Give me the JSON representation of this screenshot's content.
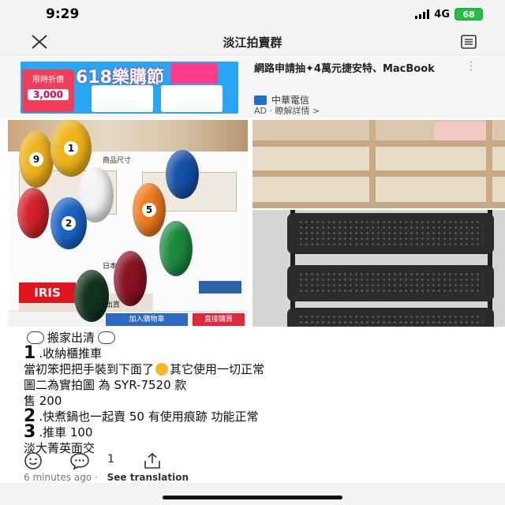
{
  "status": {
    "time": "9:29",
    "network": "4G",
    "battery": "68"
  },
  "nav": {
    "title": "淡江拍賣群",
    "close_icon": "close-icon",
    "menu_icon": "menu-icon"
  },
  "ad": {
    "banner_text": "618樂購節",
    "promo_label": "限時折價",
    "promo_price": "3,000",
    "title": "網路申請抽✦4萬元捷安特、MacBook",
    "sponsor": "中華電信",
    "meta": "AD · 瞭解詳情 >"
  },
  "photo": {
    "size_label": "商品尺寸",
    "made_label": "日本",
    "iris_label": "IRIS",
    "date_label": "/04/08 出貨",
    "cart_button": "加入購物車",
    "buy_button": "直接購買"
  },
  "post": {
    "line1": "搬家出清",
    "item1_num": "1",
    "item1_text": ".收納櫃推車",
    "line3": "當初笨把把手裝到下面了",
    "line3b": "其它使用一切正常",
    "line4": "圖二為實拍圖 為 SYR-7520 款",
    "line5": "售 200",
    "item2_num": "2",
    "item2_text": ".快煮鍋也一起賣 50 有使用痕跡 功能正常",
    "item3_num": "3",
    "item3_text": ".推車 100",
    "line8": "淡大菁英面交"
  },
  "actions": {
    "comment_count": "1"
  },
  "meta": {
    "time_ago": "6 minutes ago",
    "dot": "·",
    "see_translation": "See translation"
  }
}
